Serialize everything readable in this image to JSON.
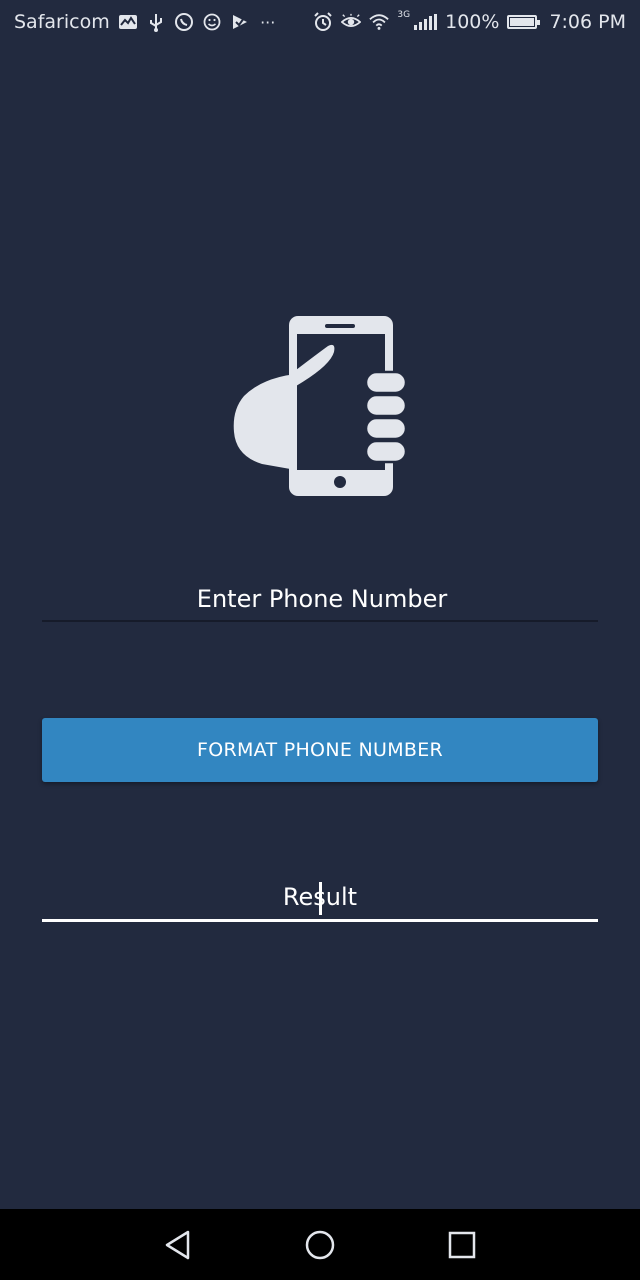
{
  "status_bar": {
    "carrier": "Safaricom",
    "network_type": "3G",
    "battery_percent": "100%",
    "time": "7:06 PM",
    "left_icons": [
      "activity-icon",
      "usb-icon",
      "whatsapp-icon",
      "smiley-icon",
      "check-flag-icon",
      "more-icon"
    ],
    "right_icons": [
      "alarm-icon",
      "eye-icon",
      "wifi-icon",
      "signal-icon",
      "battery-icon"
    ],
    "more_glyph": "···"
  },
  "main": {
    "hero_icon": "hand-holding-phone-icon",
    "phone_input": {
      "placeholder": "Enter Phone Number",
      "value": ""
    },
    "format_button_label": "FORMAT PHONE NUMBER",
    "result_field": {
      "value": "Result"
    }
  },
  "nav_bar": {
    "buttons": [
      "back-icon",
      "home-icon",
      "recents-icon"
    ]
  },
  "colors": {
    "background": "#222a3f",
    "button": "#3286c1",
    "icon": "#e3e6ec",
    "nav_bar": "#000000"
  }
}
